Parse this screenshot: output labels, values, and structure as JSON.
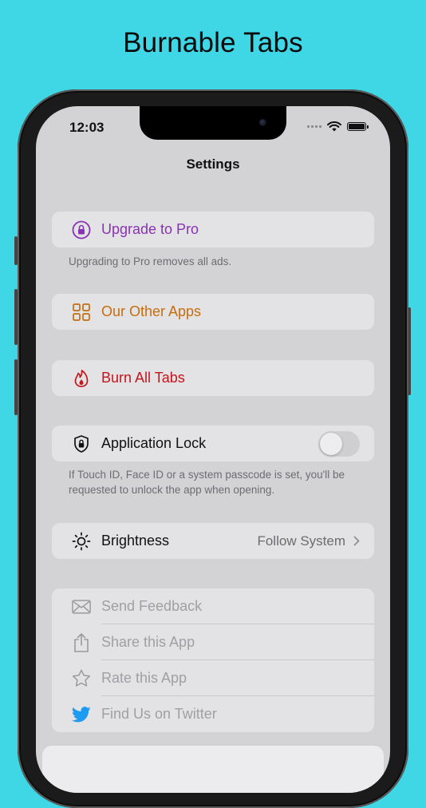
{
  "headline": "Burnable Tabs",
  "status_bar": {
    "time": "12:03"
  },
  "nav": {
    "title": "Settings"
  },
  "upgrade": {
    "label": "Upgrade to Pro",
    "footnote": "Upgrading to Pro removes all ads.",
    "color": "#8a32b5"
  },
  "other_apps": {
    "label": "Our Other Apps",
    "color": "#c56d0f"
  },
  "burn": {
    "label": "Burn All Tabs",
    "color": "#c3161c"
  },
  "app_lock": {
    "label": "Application Lock",
    "enabled": false,
    "footnote": "If Touch ID, Face ID or a system passcode is set, you'll be requested to unlock the app when opening."
  },
  "brightness": {
    "label": "Brightness",
    "value": "Follow System"
  },
  "more": {
    "items": [
      {
        "label": "Send Feedback",
        "icon": "envelope-icon"
      },
      {
        "label": "Share this App",
        "icon": "share-icon"
      },
      {
        "label": "Rate this App",
        "icon": "star-icon"
      },
      {
        "label": "Find Us on Twitter",
        "icon": "twitter-icon"
      }
    ]
  },
  "colors": {
    "background": "#3fd6e6",
    "twitter": "#1d9bf0"
  }
}
